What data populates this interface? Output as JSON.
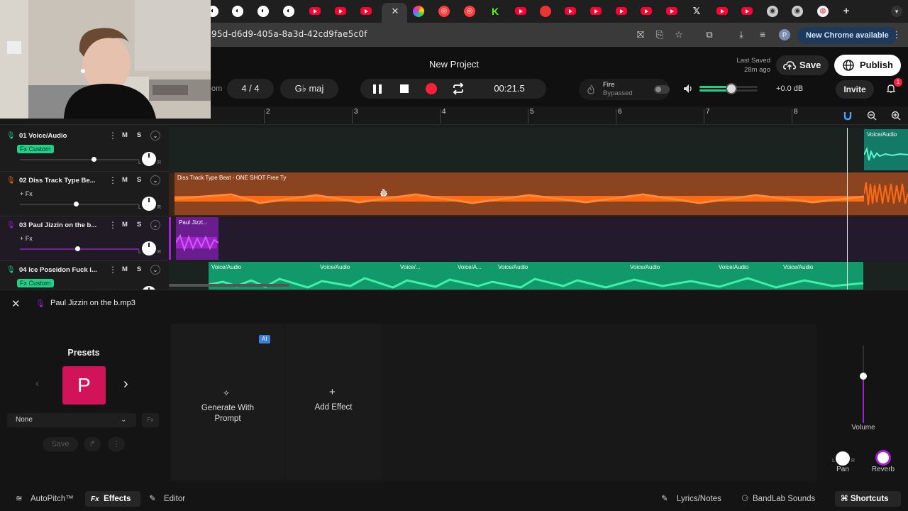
{
  "browser": {
    "url": "95d-d6d9-405a-8a3d-42cd9fae5c0f",
    "update_button": "New Chrome available",
    "profile_initial": "P"
  },
  "daw": {
    "project_title": "New Project",
    "last_saved_label": "Last Saved",
    "last_saved_time": "28m ago",
    "save_label": "Save",
    "publish_label": "Publish",
    "time_signature_prefix": "om",
    "time_signature": "4 / 4",
    "key": "G♭ maj",
    "time_display": "00:21.5",
    "fire_label": "Fire",
    "fire_status": "Bypassed",
    "master_volume": "+0.0 dB",
    "master_level": 0.62,
    "invite_label": "Invite",
    "notification_count": "1",
    "ruler": [
      "2",
      "3",
      "4",
      "5",
      "6",
      "7",
      "8"
    ]
  },
  "tracks": [
    {
      "label": "01  Voice/Audio",
      "fx": "Fx Custom",
      "volume": 0.64,
      "color": "#1fd08a"
    },
    {
      "label": "02  Diss Track Type Be...",
      "fx": "+ Fx",
      "volume": 0.49,
      "color": "#ff6a13"
    },
    {
      "label": "03  Paul Jizzin on the b...",
      "fx": "+ Fx",
      "volume": 0.51,
      "color": "#a31fd0"
    },
    {
      "label": "04  Ice Poseidon Fuck i...",
      "fx": "Fx Custom",
      "volume": 0.55,
      "color": "#1fd08a"
    }
  ],
  "clips": {
    "voice_top": "Voice/Audio",
    "diss": "Diss Track Type Beat - ONE SHOT  Free Ty",
    "paul": "Paul Jizzi...",
    "voice_row": [
      "Voice/Audio",
      "Voice/Audio",
      "Voice/...",
      "Voice/A...",
      "Voice/Audio",
      "Voice/Audio",
      "Voice/Audio",
      "Voice/Audio"
    ]
  },
  "fx_panel": {
    "track_name": "Paul Jizzin on the b.mp3",
    "presets_title": "Presets",
    "preset_letter": "P",
    "preset_value": "None",
    "save_label": "Save",
    "ai_badge": "AI",
    "generate_label_line1": "Generate With",
    "generate_label_line2": "Prompt",
    "add_effect_label": "Add Effect",
    "volume_label": "Volume",
    "pan_label": "Pan",
    "reverb_label": "Reverb",
    "volume_level": 0.6
  },
  "bottom_bar": {
    "autopitch": "AutoPitch™",
    "effects": "Effects",
    "editor": "Editor",
    "lyrics": "Lyrics/Notes",
    "sounds": "BandLab Sounds",
    "shortcuts": "Shortcuts"
  }
}
